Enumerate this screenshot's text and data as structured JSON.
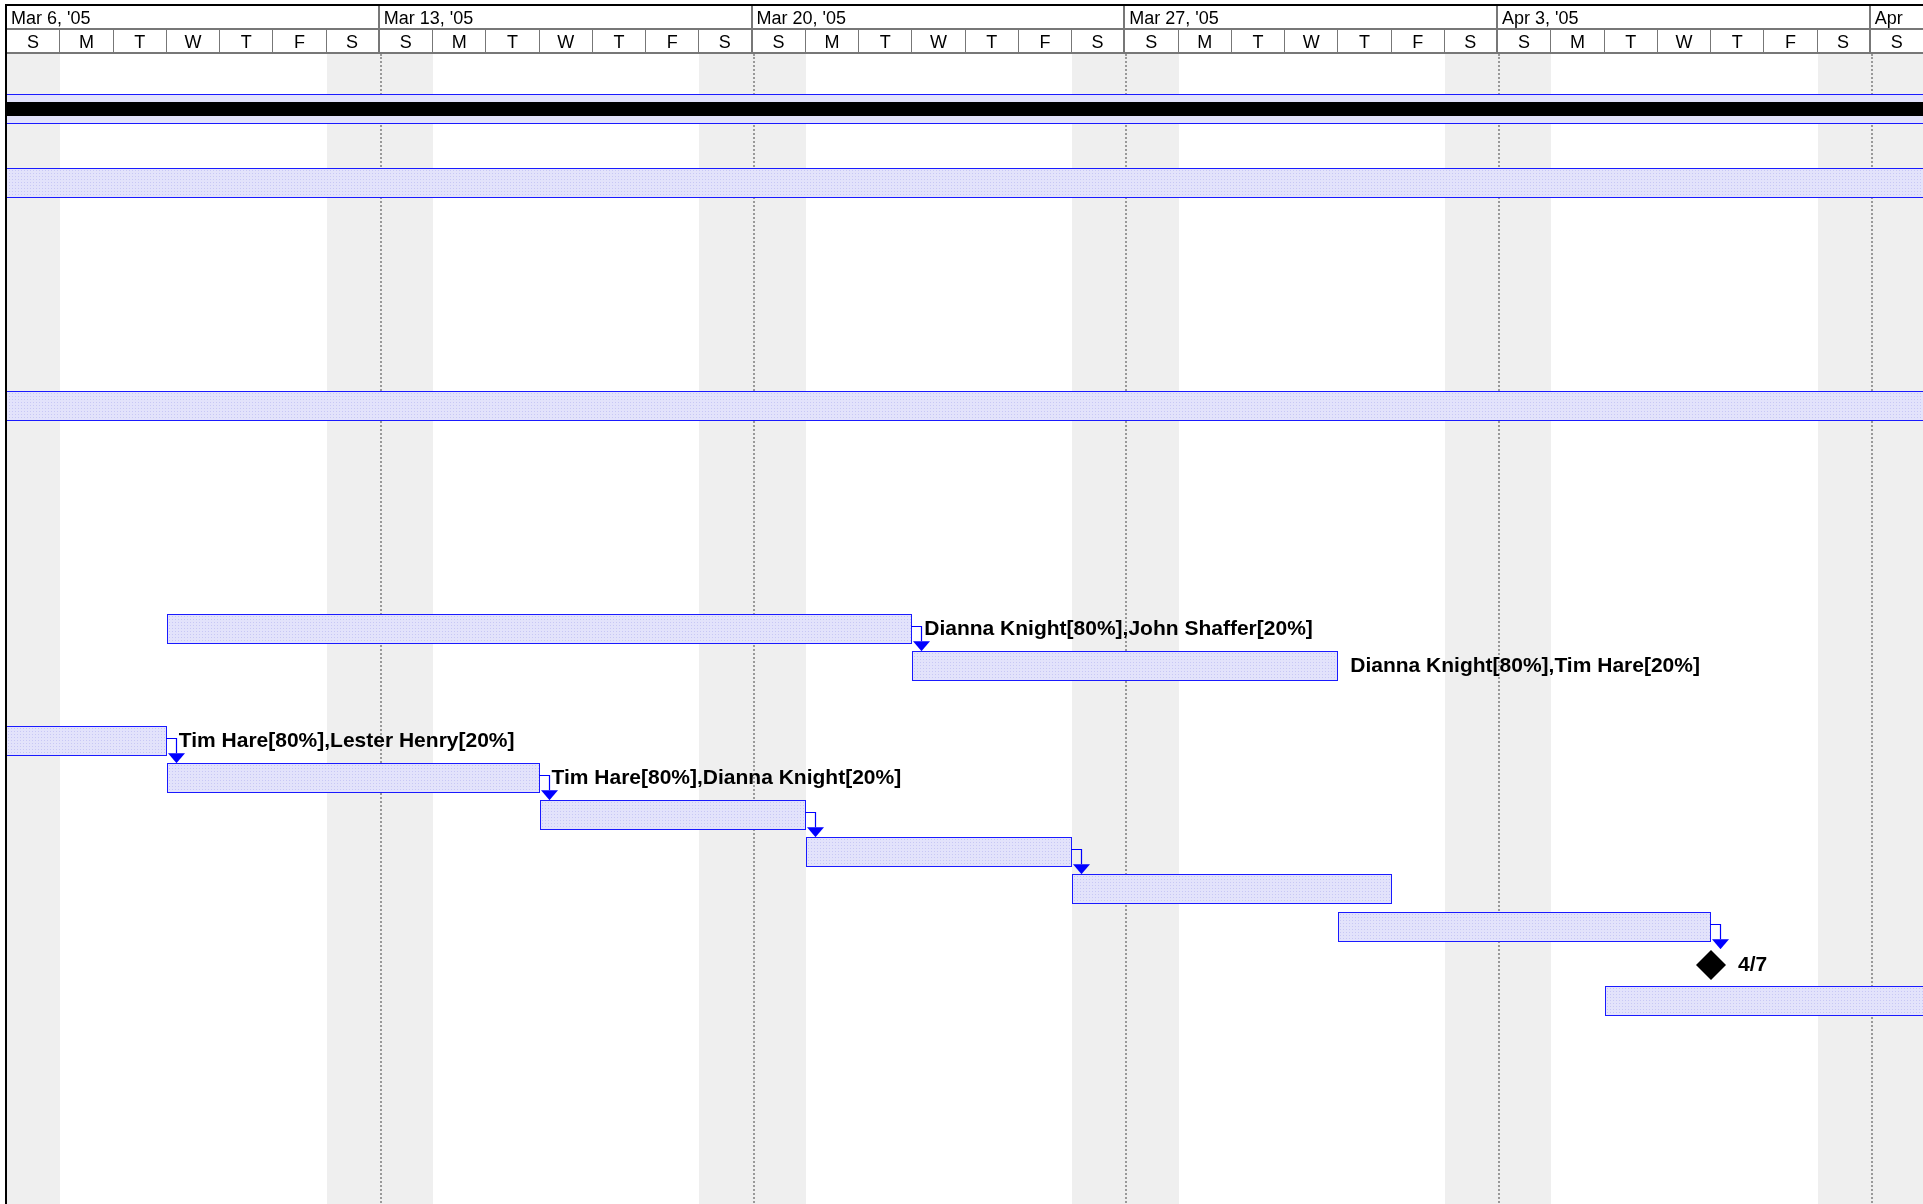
{
  "weeks": [
    {
      "label": "Mar 6, '05"
    },
    {
      "label": "Mar 13, '05"
    },
    {
      "label": "Mar 20, '05"
    },
    {
      "label": "Mar 27, '05"
    },
    {
      "label": "Apr 3, '05"
    },
    {
      "label": "Apr"
    }
  ],
  "days": [
    {
      "letter": "S",
      "nonworking": true
    },
    {
      "letter": "M",
      "nonworking": false
    },
    {
      "letter": "T",
      "nonworking": false
    },
    {
      "letter": "W",
      "nonworking": false
    },
    {
      "letter": "T",
      "nonworking": false
    },
    {
      "letter": "F",
      "nonworking": false
    },
    {
      "letter": "S",
      "nonworking": true
    },
    {
      "letter": "S",
      "nonworking": true
    },
    {
      "letter": "M",
      "nonworking": false
    },
    {
      "letter": "T",
      "nonworking": false
    },
    {
      "letter": "W",
      "nonworking": false
    },
    {
      "letter": "T",
      "nonworking": false
    },
    {
      "letter": "F",
      "nonworking": false
    },
    {
      "letter": "S",
      "nonworking": true
    },
    {
      "letter": "S",
      "nonworking": true
    },
    {
      "letter": "M",
      "nonworking": false
    },
    {
      "letter": "T",
      "nonworking": false
    },
    {
      "letter": "W",
      "nonworking": false
    },
    {
      "letter": "T",
      "nonworking": false
    },
    {
      "letter": "F",
      "nonworking": false
    },
    {
      "letter": "S",
      "nonworking": true
    },
    {
      "letter": "S",
      "nonworking": true
    },
    {
      "letter": "M",
      "nonworking": false
    },
    {
      "letter": "T",
      "nonworking": false
    },
    {
      "letter": "W",
      "nonworking": false
    },
    {
      "letter": "T",
      "nonworking": false
    },
    {
      "letter": "F",
      "nonworking": false
    },
    {
      "letter": "S",
      "nonworking": true
    },
    {
      "letter": "S",
      "nonworking": true
    },
    {
      "letter": "M",
      "nonworking": false
    },
    {
      "letter": "T",
      "nonworking": false
    },
    {
      "letter": "W",
      "nonworking": false
    },
    {
      "letter": "T",
      "nonworking": false
    },
    {
      "letter": "F",
      "nonworking": false
    },
    {
      "letter": "S",
      "nonworking": true
    },
    {
      "letter": "S",
      "nonworking": true
    }
  ],
  "rows": [
    {
      "kind": "empty"
    },
    {
      "kind": "project_summary"
    },
    {
      "kind": "empty"
    },
    {
      "kind": "task",
      "linked": false
    },
    {
      "kind": "empty"
    },
    {
      "kind": "empty"
    },
    {
      "kind": "empty"
    },
    {
      "kind": "empty"
    },
    {
      "kind": "empty"
    },
    {
      "kind": "task",
      "linked": false
    },
    {
      "kind": "empty"
    },
    {
      "kind": "empty"
    },
    {
      "kind": "empty"
    },
    {
      "kind": "empty"
    },
    {
      "kind": "empty"
    },
    {
      "kind": "task",
      "label": "Dianna Knight[80%],John Shaffer[20%]",
      "linked": true
    },
    {
      "kind": "task",
      "label": "Dianna Knight[80%],Tim Hare[20%]",
      "linked": false
    },
    {
      "kind": "empty"
    },
    {
      "kind": "task",
      "label": "Tim Hare[80%],Lester Henry[20%]",
      "linked": true
    },
    {
      "kind": "task",
      "label": "Tim Hare[80%],Dianna Knight[20%]",
      "linked": true
    },
    {
      "kind": "task",
      "linked": true
    },
    {
      "kind": "task",
      "linked": true
    },
    {
      "kind": "task",
      "linked": false
    },
    {
      "kind": "task",
      "linked": true
    },
    {
      "kind": "milestone",
      "label": "4/7"
    },
    {
      "kind": "task",
      "linked": false
    }
  ]
}
